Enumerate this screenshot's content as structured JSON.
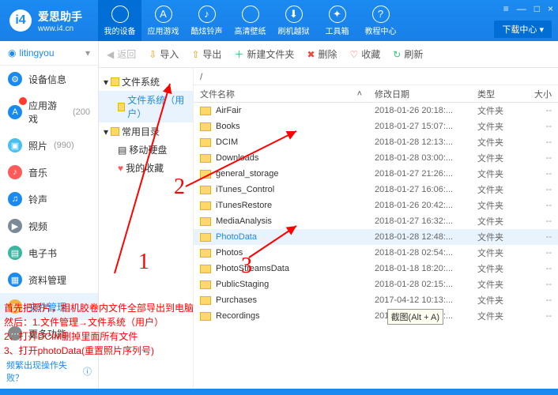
{
  "app": {
    "name": "爱思助手",
    "url": "www.i4.cn"
  },
  "winbtns": {
    "menu": "≡",
    "min": "—",
    "max": "□",
    "close": "×"
  },
  "download": "下载中心 ▾",
  "topnav": [
    {
      "icon": "",
      "label": "我的设备"
    },
    {
      "icon": "A",
      "label": "应用游戏"
    },
    {
      "icon": "♪",
      "label": "酷炫铃声"
    },
    {
      "icon": "",
      "label": "高清壁纸"
    },
    {
      "icon": "⬇",
      "label": "刷机越狱"
    },
    {
      "icon": "✦",
      "label": "工具箱"
    },
    {
      "icon": "?",
      "label": "教程中心"
    }
  ],
  "user": "litingyou",
  "sidenav": [
    {
      "color": "#1a8af0",
      "icon": "⚙",
      "label": "设备信息"
    },
    {
      "color": "#1a8af0",
      "icon": "A",
      "label": "应用游戏",
      "count": "(200",
      "badge": true
    },
    {
      "color": "#47c0ef",
      "icon": "▣",
      "label": "照片",
      "count": "(990)"
    },
    {
      "color": "#ff5a5a",
      "icon": "♪",
      "label": "音乐"
    },
    {
      "color": "#1a8af0",
      "icon": "♫",
      "label": "铃声"
    },
    {
      "color": "#7b8a97",
      "icon": "▶",
      "label": "视频"
    },
    {
      "color": "#3bb6a0",
      "icon": "▤",
      "label": "电子书"
    },
    {
      "color": "#1a8af0",
      "icon": "▦",
      "label": "资料管理"
    },
    {
      "color": "#f0b43c",
      "icon": "▥",
      "label": "文件管理",
      "active": true
    },
    {
      "color": "#888",
      "icon": "⋯",
      "label": "更多功能"
    }
  ],
  "help": "频繁出现操作失败？",
  "toolbar": {
    "back": "返回",
    "import": "导入",
    "export": "导出",
    "new": "新建文件夹",
    "del": "删除",
    "fav": "收藏",
    "refresh": "刷新"
  },
  "tree": [
    {
      "label": "文件系统",
      "exp": "▾"
    },
    {
      "label": "文件系统（用户）",
      "sub": true,
      "sel": true
    },
    {
      "label": "常用目录",
      "exp": "▾"
    },
    {
      "label": "移动硬盘",
      "sub": true,
      "icon": "disk"
    },
    {
      "label": "我的收藏",
      "sub": true,
      "icon": "heart"
    }
  ],
  "path": "/",
  "columns": {
    "name": "文件名称",
    "date": "修改日期",
    "type": "类型",
    "size": "大小"
  },
  "files": [
    {
      "n": "AirFair",
      "d": "2018-01-26 20:18:...",
      "t": "文件夹",
      "s": "--"
    },
    {
      "n": "Books",
      "d": "2018-01-27 15:07:...",
      "t": "文件夹",
      "s": "--"
    },
    {
      "n": "DCIM",
      "d": "2018-01-28 12:13:...",
      "t": "文件夹",
      "s": "--"
    },
    {
      "n": "Downloads",
      "d": "2018-01-28 03:00:...",
      "t": "文件夹",
      "s": "--"
    },
    {
      "n": "general_storage",
      "d": "2018-01-27 21:26:...",
      "t": "文件夹",
      "s": "--"
    },
    {
      "n": "iTunes_Control",
      "d": "2018-01-27 16:06:...",
      "t": "文件夹",
      "s": "--"
    },
    {
      "n": "iTunesRestore",
      "d": "2018-01-26 20:42:...",
      "t": "文件夹",
      "s": "--"
    },
    {
      "n": "MediaAnalysis",
      "d": "2018-01-27 16:32:...",
      "t": "文件夹",
      "s": "--"
    },
    {
      "n": "PhotoData",
      "d": "2018-01-28 12:48:...",
      "t": "文件夹",
      "s": "--",
      "sel": true
    },
    {
      "n": "Photos",
      "d": "2018-01-28 02:54:...",
      "t": "文件夹",
      "s": "--"
    },
    {
      "n": "PhotoStreamsData",
      "d": "2018-01-18 18:20:...",
      "t": "文件夹",
      "s": "--"
    },
    {
      "n": "PublicStaging",
      "d": "2018-01-28 02:15:...",
      "t": "文件夹",
      "s": "--"
    },
    {
      "n": "Purchases",
      "d": "2017-04-12 10:13:...",
      "t": "文件夹",
      "s": "--"
    },
    {
      "n": "Recordings",
      "d": "2018-01-27 15:06:...",
      "t": "文件夹",
      "s": "--"
    }
  ],
  "tooltip": "截图(Alt + A)",
  "anno": {
    "line1": "首先把照片，相机胶卷内文件全部导出到电脑",
    "line2": "然后：1.文件管理→文件系统（用户）",
    "line3": "2、打开DCIM删掉里面所有文件",
    "line4": "3、打开photoData(重置照片序列号)",
    "n1": "1",
    "n2": "2",
    "n3": "3"
  }
}
